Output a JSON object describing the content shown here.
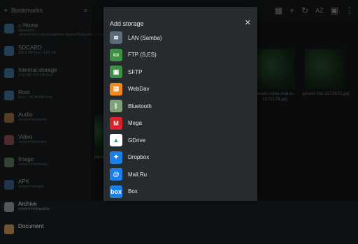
{
  "sidebar": {
    "title": "Bookmarks",
    "items": [
      {
        "label": "⌂ Home",
        "sub": "/data/data/ ... content://com.lonelycatgames.Xplore.FileSystem.Home",
        "color": "#5aa0d8"
      },
      {
        "label": "SDCARD",
        "sub": "309.9 MB free / 3.84 GB",
        "color": "#5aa0d8"
      },
      {
        "label": "Internal storage",
        "sub": "3.51 GB / 4.5 GB Free",
        "color": "#5aa0d8"
      },
      {
        "label": "Root",
        "sub": "Root /, 40.44 MB Free",
        "color": "#5aa0d8"
      },
      {
        "label": "Audio",
        "sub": "content://mx/audio",
        "color": "#d9a04b"
      },
      {
        "label": "Video",
        "sub": "content://mx/video",
        "color": "#d16a6a"
      },
      {
        "label": "Image",
        "sub": "content://mx/image",
        "color": "#7bb07a"
      },
      {
        "label": "APK",
        "sub": "content://mx/apk",
        "color": "#4f86c9"
      },
      {
        "label": "Archive",
        "sub": "content://mx/archive",
        "color": "#8d8d8d"
      },
      {
        "label": "Document",
        "sub": "",
        "color": "#c08a4a"
      }
    ]
  },
  "content": {
    "thumbs": [
      {
        "caption": "pexels-catia-matos-1072179.jpg"
      },
      {
        "caption": "pexels-fox-1172675.jpg"
      }
    ],
    "partial_caption": "pexe"
  },
  "toolbar": {
    "icons": [
      "grid-icon",
      "add-icon",
      "refresh-icon",
      "sort-az-icon",
      "select-icon",
      "more-icon"
    ]
  },
  "dialog": {
    "title": "Add storage",
    "items": [
      {
        "label": "LAN (Samba)",
        "icon": "wifi-icon",
        "color": "#5b6b7a",
        "glyph": "≋"
      },
      {
        "label": "FTP (S,ES)",
        "icon": "ftp-icon",
        "color": "#3f8f45",
        "glyph": "▭"
      },
      {
        "label": "SFTP",
        "icon": "sftp-icon",
        "color": "#3f8f45",
        "glyph": "▣"
      },
      {
        "label": "WebDav",
        "icon": "webdav-icon",
        "color": "#f08a19",
        "glyph": "▤"
      },
      {
        "label": "Bluetooth",
        "icon": "bluetooth-icon",
        "color": "#7fa07a",
        "glyph": "ᛒ"
      },
      {
        "label": "Mega",
        "icon": "mega-icon",
        "color": "#d9242b",
        "glyph": "M"
      },
      {
        "label": "GDrive",
        "icon": "gdrive-icon",
        "color": "#ffffff",
        "glyph": "▲"
      },
      {
        "label": "Dropbox",
        "icon": "dropbox-icon",
        "color": "#1a7fe6",
        "glyph": "✦"
      },
      {
        "label": "Mail.Ru",
        "icon": "mailru-icon",
        "color": "#1a7fe6",
        "glyph": "@"
      },
      {
        "label": "Box",
        "icon": "box-icon",
        "color": "#1a7fe6",
        "glyph": "box"
      }
    ]
  }
}
